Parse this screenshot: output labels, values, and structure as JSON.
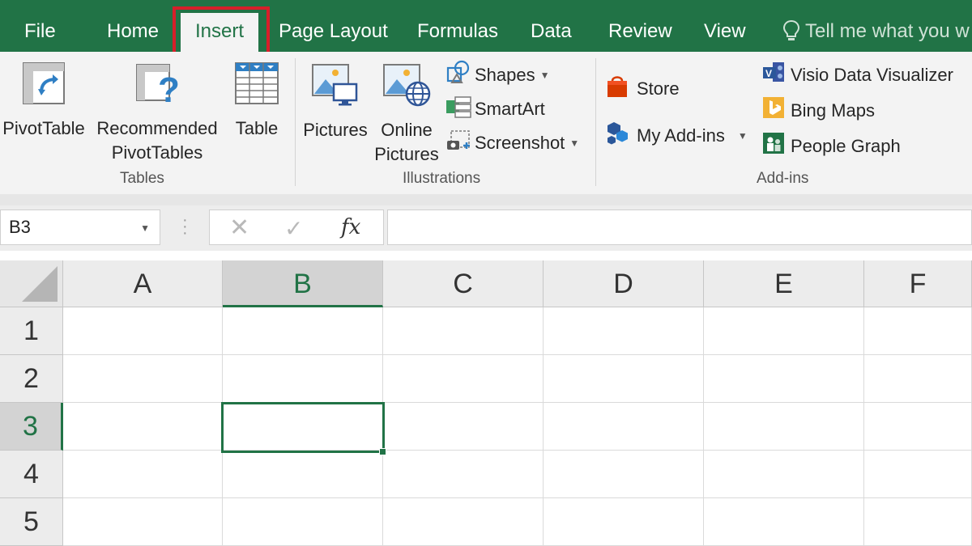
{
  "tabs": {
    "file": "File",
    "home": "Home",
    "insert": "Insert",
    "page_layout": "Page Layout",
    "formulas": "Formulas",
    "data": "Data",
    "review": "Review",
    "view": "View",
    "tell_me": "Tell me what you w"
  },
  "ribbon": {
    "tables": {
      "label": "Tables",
      "pivottable": "PivotTable",
      "recommended_line1": "Recommended",
      "recommended_line2": "PivotTables",
      "table": "Table"
    },
    "illustrations": {
      "label": "Illustrations",
      "pictures": "Pictures",
      "online_line1": "Online",
      "online_line2": "Pictures",
      "shapes": "Shapes",
      "smartart": "SmartArt",
      "screenshot": "Screenshot"
    },
    "addins": {
      "label": "Add-ins",
      "store": "Store",
      "my_addins": "My Add-ins",
      "visio": "Visio Data Visualizer",
      "bing_maps": "Bing Maps",
      "people_graph": "People Graph"
    }
  },
  "formula_bar": {
    "name_box": "B3",
    "fx": "fx",
    "value": ""
  },
  "grid": {
    "columns": [
      "A",
      "B",
      "C",
      "D",
      "E",
      "F"
    ],
    "rows": [
      "1",
      "2",
      "3",
      "4",
      "5"
    ],
    "selected_cell": "B3"
  },
  "colors": {
    "accent": "#217346",
    "highlight": "#d71f2a"
  },
  "icons": {
    "bulb": "lightbulb-icon",
    "pivot": "pivottable-icon",
    "recommended": "recommended-pivottables-icon",
    "table": "table-icon",
    "pictures": "pictures-icon",
    "online": "online-pictures-icon",
    "shapes": "shapes-icon",
    "smartart": "smartart-icon",
    "screenshot": "screenshot-icon",
    "store": "store-icon",
    "myaddins": "my-addins-icon",
    "visio": "visio-icon",
    "bing": "bing-maps-icon",
    "people": "people-graph-icon"
  }
}
